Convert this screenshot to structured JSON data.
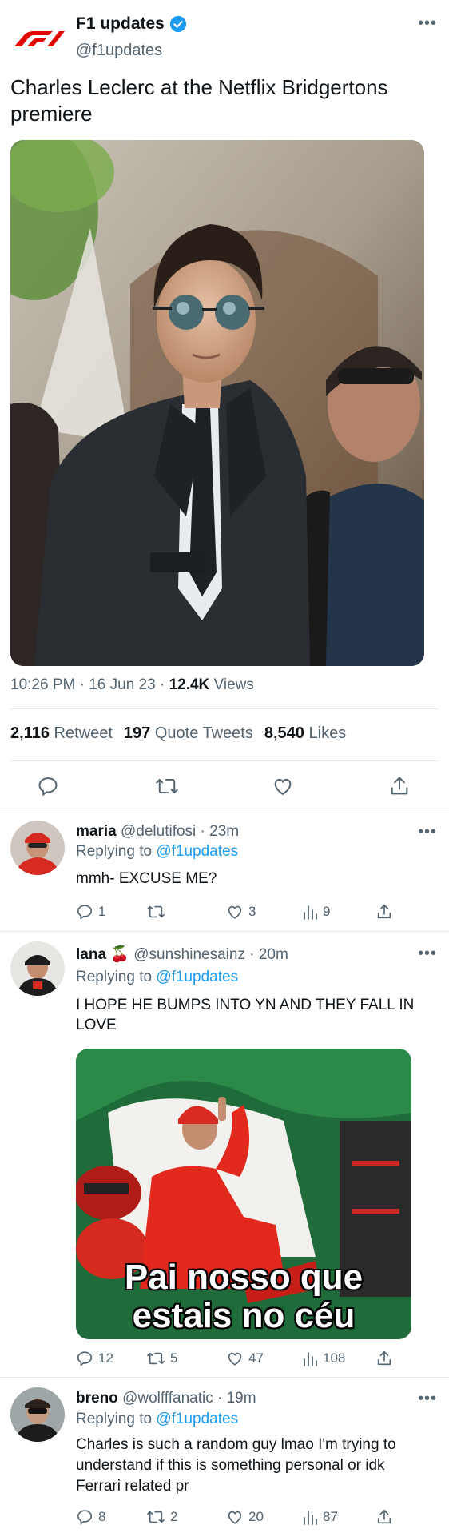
{
  "tweet": {
    "author_name": "F1 updates",
    "author_handle": "@f1updates",
    "text": "Charles Leclerc at the Netflix Bridgertons premiere",
    "time": "10:26 PM · 16 Jun 23 · ",
    "views_count": "12.4K",
    "views_label": " Views",
    "stats": {
      "retweets": "2,116",
      "retweets_label": "Retweet",
      "quotes": "197",
      "quotes_label": "Quote Tweets",
      "likes": "8,540",
      "likes_label": "Likes"
    },
    "icons": [
      "reply-icon",
      "retweet-icon",
      "like-icon",
      "share-icon"
    ]
  },
  "replies": [
    {
      "name": "maria",
      "handle": "@delutifosi · 23m",
      "replying_prefix": "Replying to ",
      "replying_to": "@f1updates",
      "text": "mmh- EXCUSE ME?",
      "counts": {
        "reply": "1",
        "retweet": "",
        "like": "3",
        "views": "9"
      }
    },
    {
      "name": "lana 🍒",
      "handle": "@sunshinesainz · 20m",
      "replying_prefix": "Replying to ",
      "replying_to": "@f1updates",
      "text": "I HOPE HE BUMPS INTO YN AND THEY FALL IN LOVE",
      "meme_line1": "Pai nosso que",
      "meme_line2": "estais no céu",
      "counts": {
        "reply": "12",
        "retweet": "5",
        "like": "47",
        "views": "108"
      }
    },
    {
      "name": "breno",
      "handle": "@wolfffanatic · 19m",
      "replying_prefix": "Replying to ",
      "replying_to": "@f1updates",
      "text": "Charles is such a random guy lmao I'm trying to understand if this is something personal or idk Ferrari related pr",
      "counts": {
        "reply": "8",
        "retweet": "2",
        "like": "20",
        "views": "87"
      }
    }
  ],
  "colors": {
    "accent": "#1d9bf0",
    "muted": "#536471",
    "f1_red": "#e10600",
    "divider": "#e7e9ea"
  }
}
